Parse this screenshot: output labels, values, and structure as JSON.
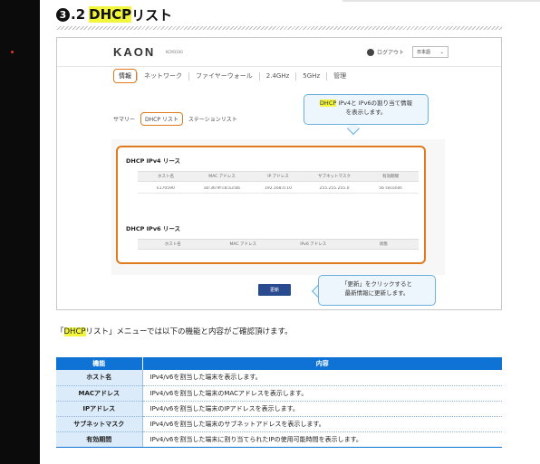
{
  "section": {
    "number": "3",
    "suffix": ".2",
    "title_highlight": "DHCP",
    "title_rest": "リスト"
  },
  "screen": {
    "logo": "KAON",
    "model": "KCM3100",
    "logout": "ログアウト",
    "language": "日本語",
    "nav": [
      "情報",
      "ネットワーク",
      "ファイヤーウォール",
      "2.4GHz",
      "5GHz",
      "管理"
    ],
    "subnav": [
      "サマリー",
      "DHCP リスト",
      "ステーションリスト"
    ],
    "ipv4": {
      "heading": "DHCP IPv4 リース",
      "columns": [
        "ホスト名",
        "MAC アドレス",
        "IP アドレス",
        "サブネットマスク",
        "有効期間"
      ],
      "rows": [
        [
          "k170590",
          "a0:36:9f:c8:a3:bb",
          "192.168.0.10",
          "255.255.255.0",
          "56 seconds"
        ]
      ]
    },
    "ipv6": {
      "heading": "DHCP IPv6 リース",
      "columns": [
        "ホスト名",
        "MAC アドレス",
        "IPv6 アドレス",
        "状態"
      ]
    },
    "update_button": "更新",
    "callout1": {
      "hl": "DHCP",
      "line1": " IPv4と IPv6の割り当て情報",
      "line2": "を表示します。"
    },
    "callout2": {
      "line1": "「更新」をクリックすると",
      "line2": "最新情報に更新します。"
    }
  },
  "description": {
    "open": "「",
    "hl": "DHCP",
    "rest": "リスト」メニューでは以下の機能と内容がご確認頂けます。"
  },
  "features": {
    "headers": [
      "機能",
      "内容"
    ],
    "rows": [
      [
        "ホスト名",
        "IPv4/v6を割当した端末を表示します。"
      ],
      [
        "MACアドレス",
        "IPv4/v6を割当した端末のMACアドレスを表示します。"
      ],
      [
        "IPアドレス",
        "IPv4/v6を割当した端末のIPアドレスを表示します。"
      ],
      [
        "サブネットマスク",
        "IPv4/v6を割当した端末のサブネットアドレスを表示します。"
      ],
      [
        "有効期間",
        "IPv4/v6を割当した端末に割り当てられたIPの使用可能時間を表示します。"
      ]
    ]
  },
  "colors": {
    "accent_orange": "#e07a1f",
    "header_blue": "#0f73d6",
    "highlight_yellow": "#f2f53c",
    "callout_border": "#6db0dc"
  }
}
